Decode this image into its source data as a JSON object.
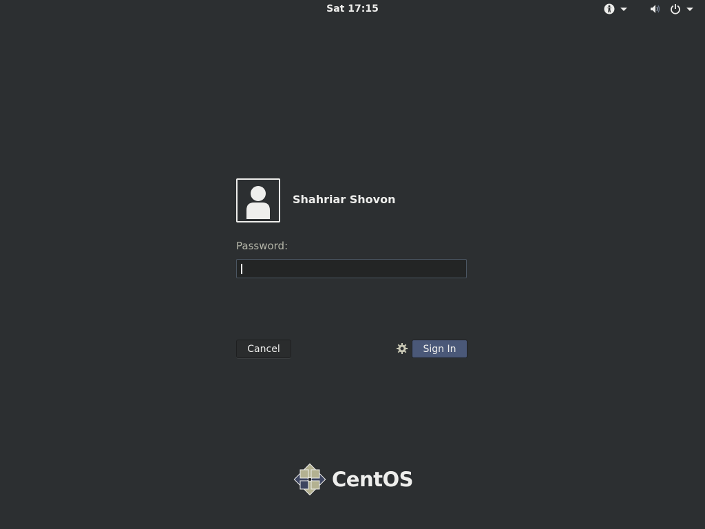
{
  "topbar": {
    "clock": "Sat 17:15",
    "icons": [
      "accessibility-icon",
      "volume-icon",
      "power-icon"
    ]
  },
  "login": {
    "username": "Shahriar Shovon",
    "password_label": "Password:",
    "password_value": "",
    "cancel_label": "Cancel",
    "signin_label": "Sign In"
  },
  "branding": {
    "logo_text": "CentOS"
  },
  "colors": {
    "background": "#2c2f31",
    "signin_button": "#4a5878",
    "label": "#b5b6a9"
  }
}
